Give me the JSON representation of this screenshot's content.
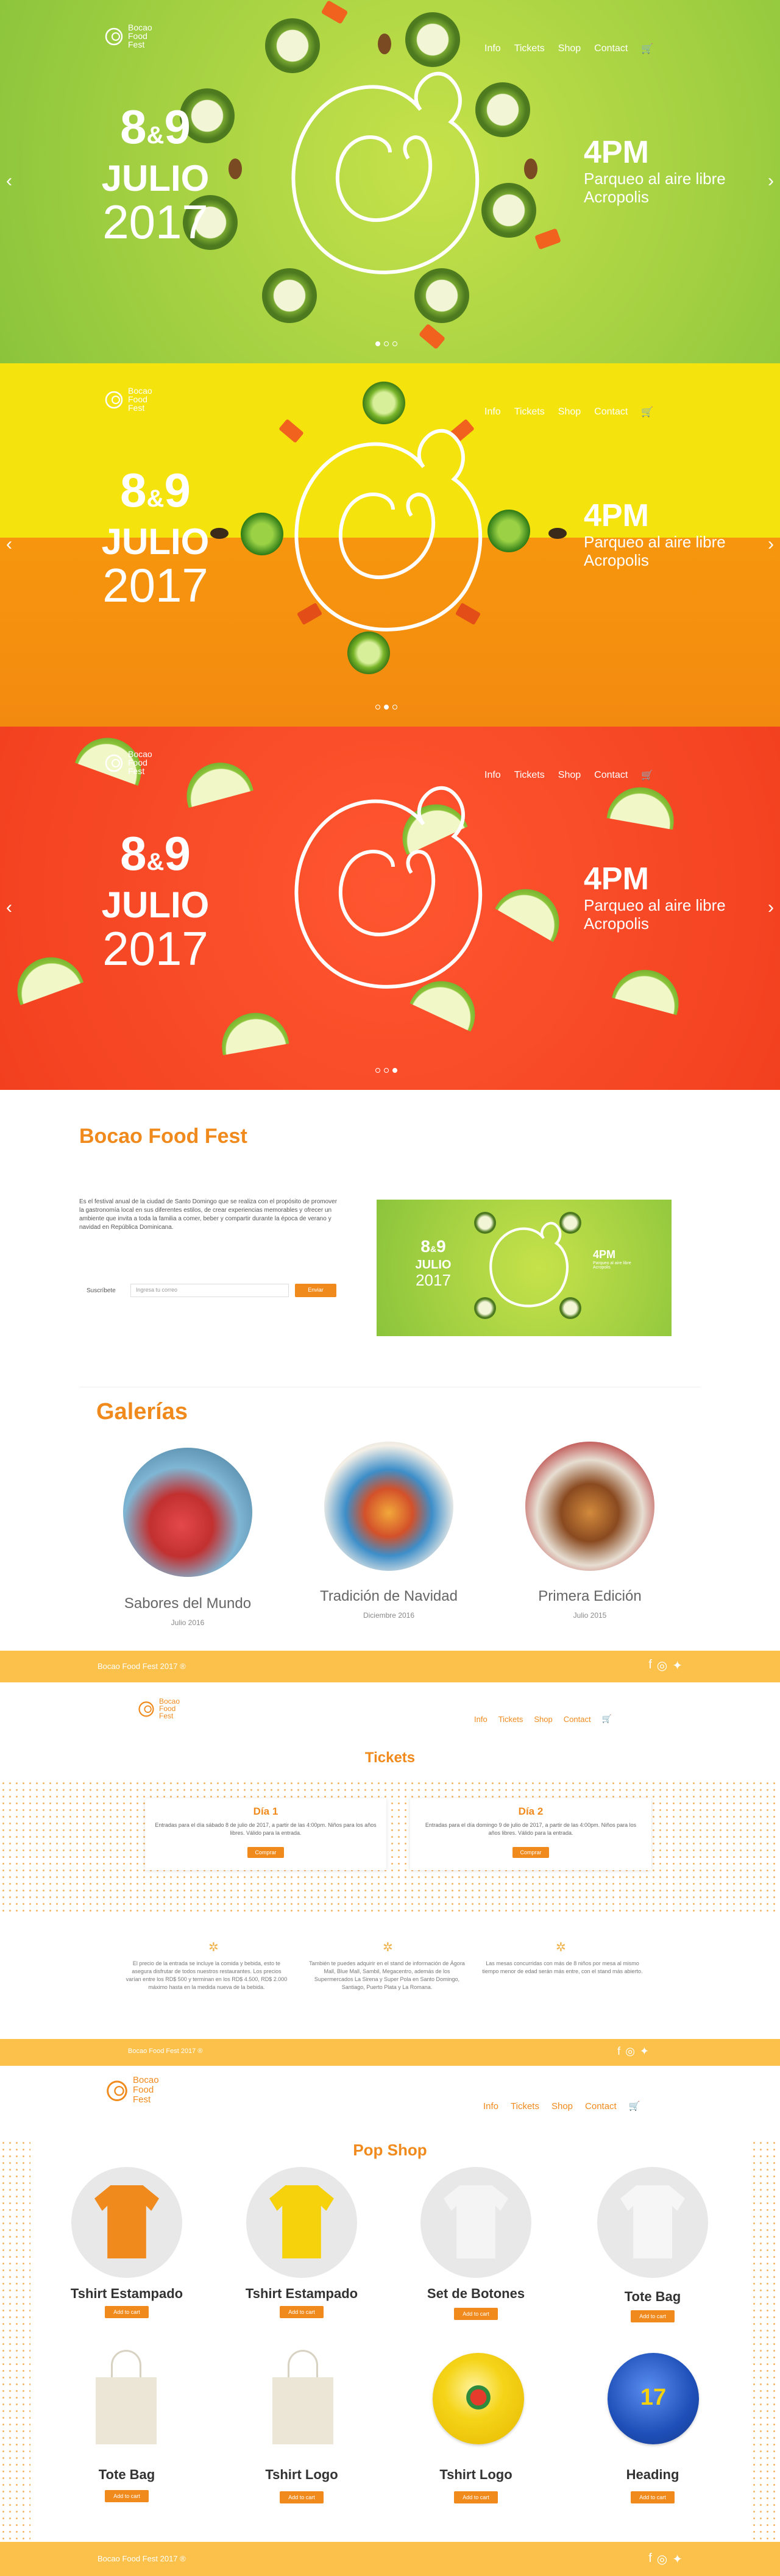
{
  "brand": {
    "logo_line1": "Bocao",
    "logo_line2": "Food",
    "logo_line3": "Fest"
  },
  "nav": {
    "info": "Info",
    "tickets": "Tickets",
    "shop": "Shop",
    "contact": "Contact",
    "cart_icon": "cart-icon"
  },
  "hero": {
    "day1": "8",
    "amp": "&",
    "day2": "9",
    "month": "JULIO",
    "year": "2017",
    "time": "4PM",
    "place_line1": "Parqueo al aire libre",
    "place_line2": "Acropolis",
    "prev_icon": "chevron-left-icon",
    "next_icon": "chevron-right-icon"
  },
  "about": {
    "title": "Bocao Food Fest",
    "text": "Es el festival anual de la ciudad de Santo Domingo que se realiza con el propósito de promover la gastronomía local en sus diferentes estilos, de crear experiencias memorables y ofrecer un ambiente que invita a toda la familia a comer, beber y compartir durante la época de verano y navidad en República Dominicana.",
    "subscribe_label": "Suscríbete",
    "input_placeholder": "Ingresa tu correo",
    "button": "Enviar",
    "mini_day1": "8",
    "mini_amp": "&",
    "mini_day2": "9",
    "mini_month": "JULIO",
    "mini_year": "2017",
    "mini_time": "4PM",
    "mini_place": "Parqueo al aire libre Acropolis"
  },
  "gallery": {
    "title": "Galerías",
    "items": [
      {
        "name": "Sabores del Mundo",
        "date": "Julio 2016"
      },
      {
        "name": "Tradición de Navidad",
        "date": "Diciembre 2016"
      },
      {
        "name": "Primera Edición",
        "date": "Julio 2015"
      }
    ]
  },
  "footer": {
    "text": "Bocao Food Fest 2017 ®",
    "social": [
      "facebook-icon",
      "instagram-icon",
      "twitter-icon"
    ]
  },
  "tickets": {
    "title": "Tickets",
    "cards": [
      {
        "title": "Día 1",
        "text": "Entradas para el día sábado 8 de julio de 2017, a partir de las 4:00pm. Niños para los años libres. Válido para la entrada.",
        "button": "Comprar"
      },
      {
        "title": "Día 2",
        "text": "Entradas para el día domingo 9 de julio de 2017, a partir de las 4:00pm. Niños para los años libres. Válido para la entrada.",
        "button": "Comprar"
      }
    ],
    "info": [
      "El precio de la entrada se incluye la comida y bebida, esto te asegura disfrutar de todos nuestros restaurantes. Los precios varían entre los RD$ 500 y terminan en los RD$ 4.500, RD$ 2.000 máximo hasta en la medida nueva de la bebida.",
      "También te puedes adquirir en el stand de información de Ágora Mall, Blue Mall, Sambil, Megacentro, además de los Supermercados La Sirena y Super Pola en Santo Domingo, Santiago, Puerto Plata y La Romana.",
      "Las mesas concurridas con más de 8 niños por mesa al mismo tiempo menor de edad serán más entre, con el stand más abierto."
    ]
  },
  "shop": {
    "title": "Pop Shop",
    "add_label": "Add to cart",
    "products": [
      {
        "name": "Tshirt Estampado",
        "kind": "tshirt-orange"
      },
      {
        "name": "Tshirt Estampado",
        "kind": "tshirt-yellow"
      },
      {
        "name": "Set de Botones",
        "kind": "tshirt-white"
      },
      {
        "name": "Tote Bag",
        "kind": "tshirt-white2"
      },
      {
        "name": "Tote Bag",
        "kind": "tote"
      },
      {
        "name": "Tshirt Logo",
        "kind": "tote2"
      },
      {
        "name": "Tshirt Logo",
        "kind": "button-yellow"
      },
      {
        "name": "Heading",
        "kind": "button-blue"
      }
    ]
  },
  "colors": {
    "accent": "#f08a1c",
    "footer": "#fbc14b",
    "green": "#8bc43c",
    "yellow": "#f4e30d",
    "red": "#f2401f"
  }
}
